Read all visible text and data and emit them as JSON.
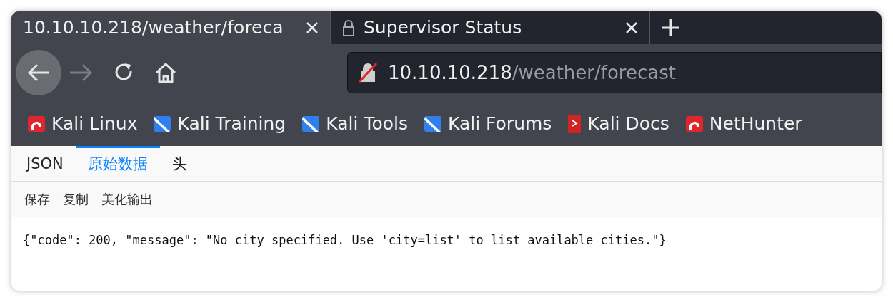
{
  "tabs": [
    {
      "title": "10.10.10.218/weather/foreca",
      "selected": true,
      "kind": "plain"
    },
    {
      "title": "Supervisor Status",
      "selected": false,
      "kind": "locked"
    }
  ],
  "address": {
    "host": "10.10.10.218",
    "path": "/weather/forecast"
  },
  "bookmarks": [
    {
      "label": "Kali Linux",
      "kind": "kali"
    },
    {
      "label": "Kali Training",
      "kind": "tool"
    },
    {
      "label": "Kali Tools",
      "kind": "tool"
    },
    {
      "label": "Kali Forums",
      "kind": "tool"
    },
    {
      "label": "Kali Docs",
      "kind": "doc"
    },
    {
      "label": "NetHunter",
      "kind": "kali"
    }
  ],
  "viewer_tabs": [
    {
      "label": "JSON",
      "selected": false
    },
    {
      "label": "原始数据",
      "selected": true
    },
    {
      "label": "头",
      "selected": false
    }
  ],
  "viewer_actions": [
    "保存",
    "复制",
    "美化输出"
  ],
  "raw_text": "{\"code\": 200, \"message\": \"No city specified. Use 'city=list' to list available cities.\"}"
}
